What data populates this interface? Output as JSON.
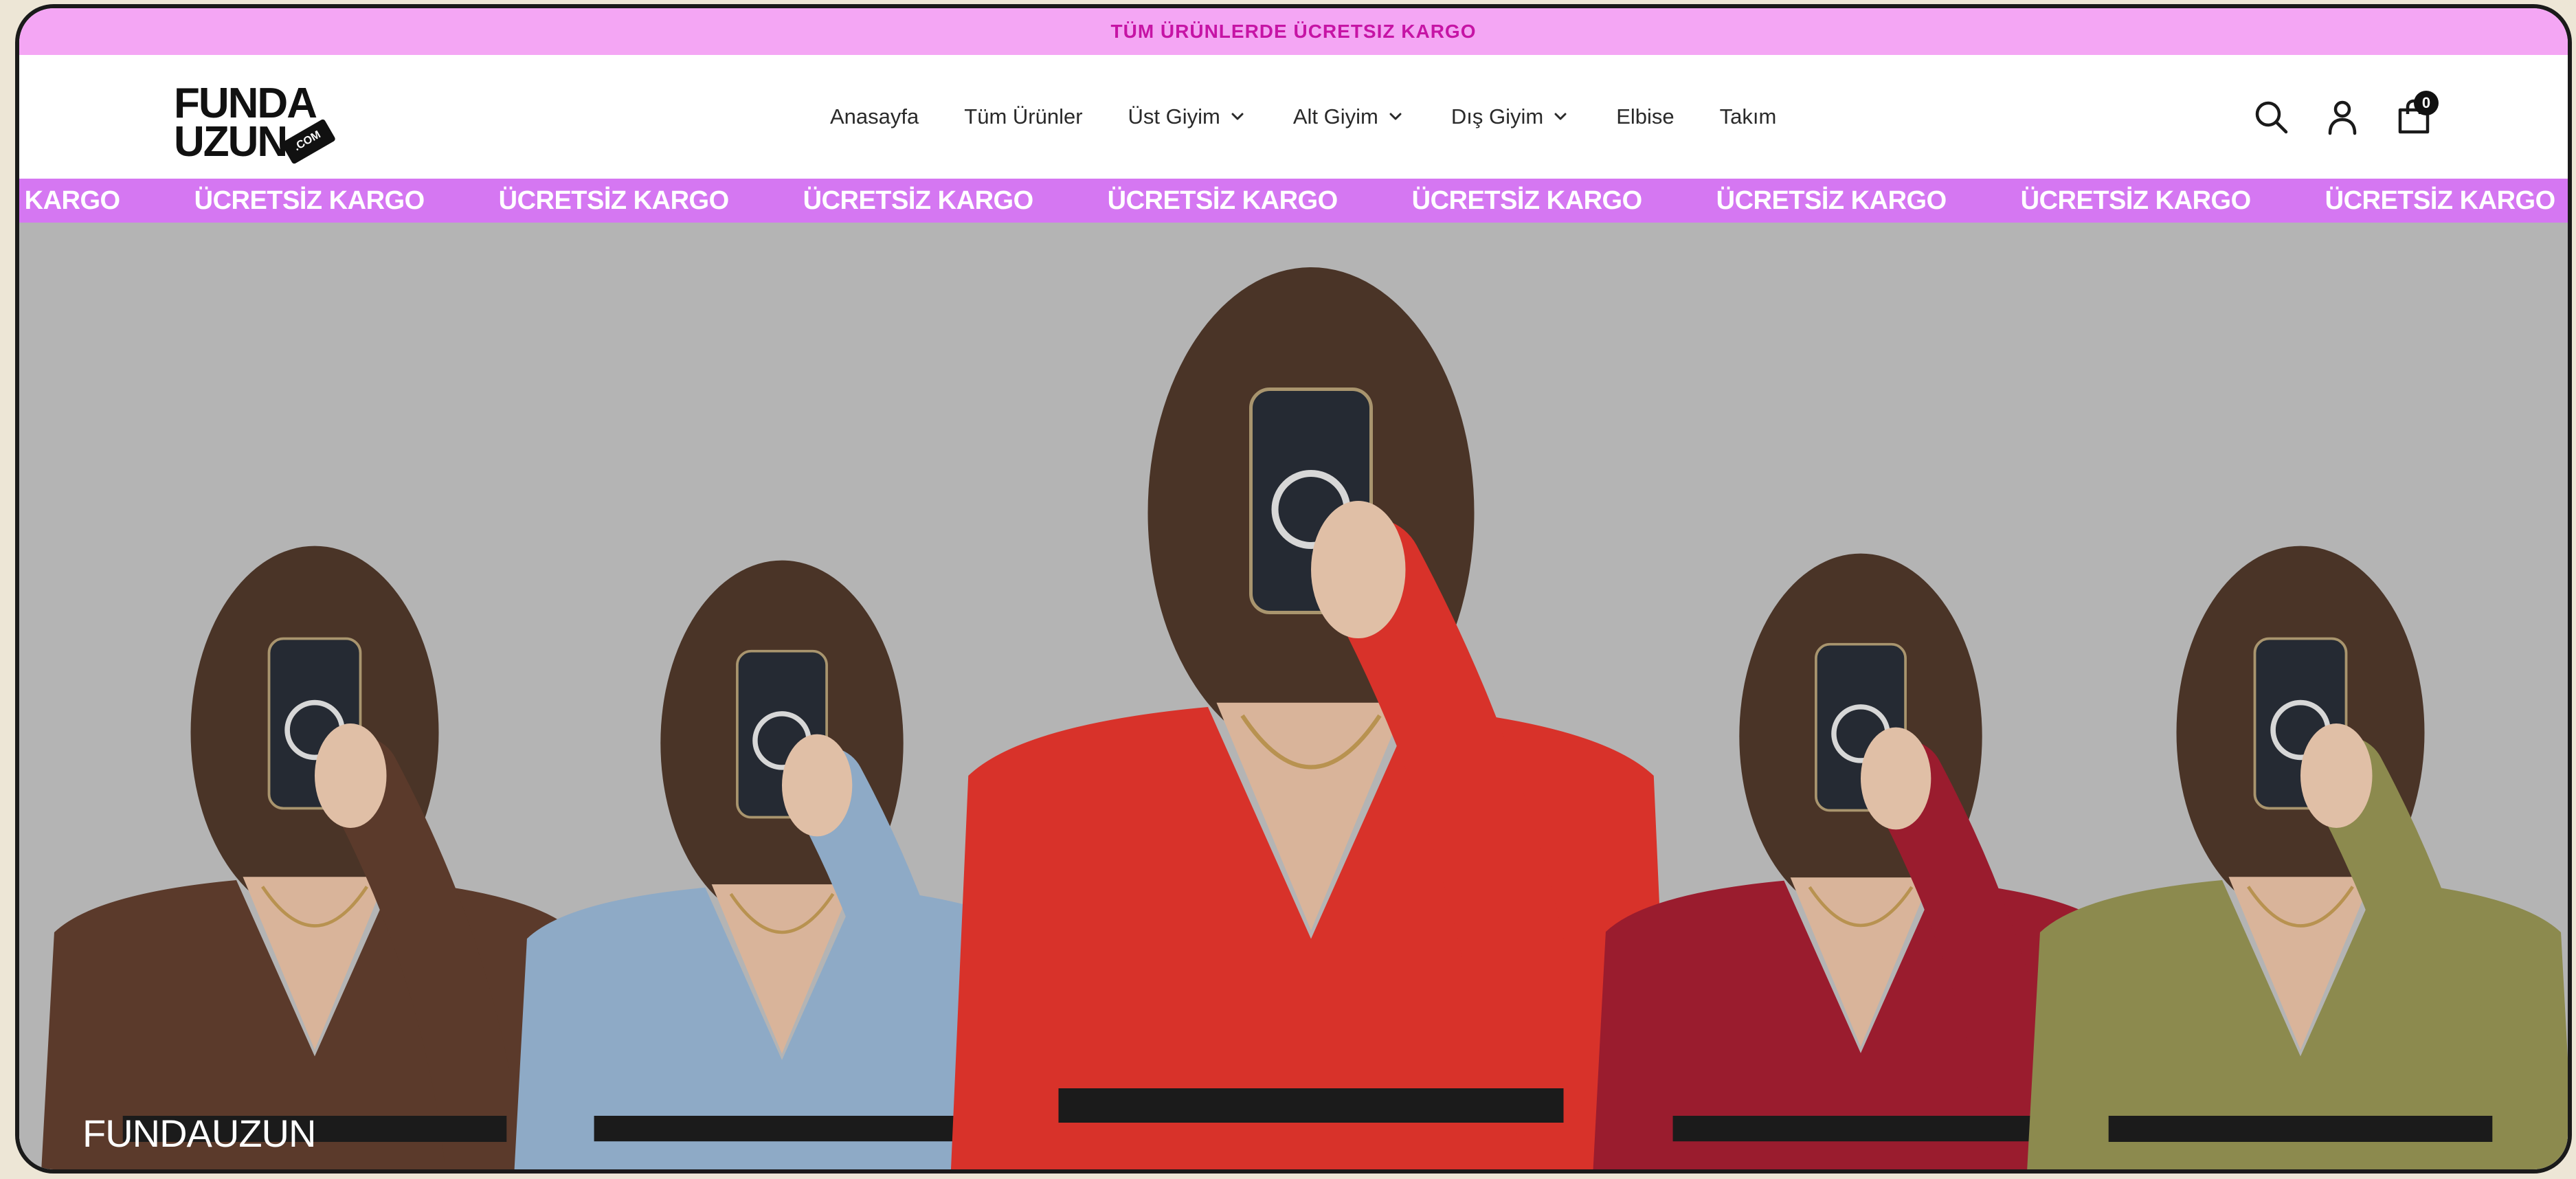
{
  "announcement": {
    "text": "TÜM ÜRÜNLERDE ÜCRETSIZ KARGO"
  },
  "logo": {
    "line1": "FUNDA",
    "line2": "UZUN",
    "tag": ".COM"
  },
  "nav": {
    "items": [
      {
        "label": "Anasayfa",
        "dropdown": false
      },
      {
        "label": "Tüm Ürünler",
        "dropdown": false
      },
      {
        "label": "Üst Giyim",
        "dropdown": true
      },
      {
        "label": "Alt Giyim",
        "dropdown": true
      },
      {
        "label": "Dış Giyim",
        "dropdown": true
      },
      {
        "label": "Elbise",
        "dropdown": false
      },
      {
        "label": "Takım",
        "dropdown": false
      }
    ]
  },
  "header_icons": {
    "search": "search-icon",
    "account": "user-icon",
    "cart": "bag-icon",
    "cart_count": "0"
  },
  "marquee": {
    "items": [
      "SİZ KARGO",
      "ÜCRETSİZ KARGO",
      "ÜCRETSİZ KARGO",
      "ÜCRETSİZ KARGO",
      "ÜCRETSİZ KARGO",
      "ÜCRETSİZ KARGO",
      "ÜCRETSİZ KARGO",
      "ÜCRETSİZ KARGO",
      "ÜCRETSİZ KARGO",
      "ÜCRETSİZ KARGO"
    ]
  },
  "hero": {
    "brand": "FUNDAUZUN",
    "shirt_colors": [
      "#5b3a2b",
      "#8eaac6",
      "#d8322a",
      "#9a1c2e",
      "#8c8a4e"
    ]
  },
  "colors": {
    "announcement_bg": "#f4a6f4",
    "announcement_text": "#c614a5",
    "marquee_bg": "#d577f2",
    "hero_bg": "#b4b4b4"
  }
}
